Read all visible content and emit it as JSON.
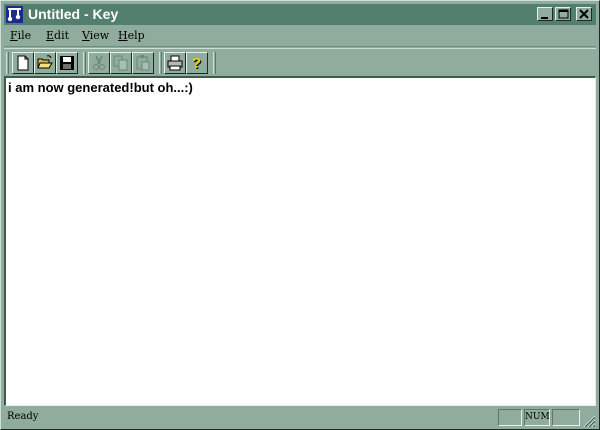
{
  "window": {
    "title": "Untitled - Key",
    "controls": {
      "minimize": "minimize",
      "maximize": "maximize",
      "close": "close"
    }
  },
  "menubar": {
    "items": [
      {
        "label": "File"
      },
      {
        "label": "Edit"
      },
      {
        "label": "View"
      },
      {
        "label": "Help"
      }
    ]
  },
  "toolbar": {
    "buttons": [
      {
        "icon": "new-document-icon",
        "enabled": true
      },
      {
        "icon": "open-folder-icon",
        "enabled": true
      },
      {
        "icon": "save-disk-icon",
        "enabled": true
      },
      {
        "icon": "cut-scissors-icon",
        "enabled": false
      },
      {
        "icon": "copy-icon",
        "enabled": false
      },
      {
        "icon": "paste-clipboard-icon",
        "enabled": false
      },
      {
        "icon": "print-icon",
        "enabled": true
      },
      {
        "icon": "help-question-icon",
        "enabled": true
      }
    ]
  },
  "editor": {
    "content": "i am now generated!but oh...:)"
  },
  "statusbar": {
    "message": "Ready",
    "indicators": [
      "",
      "NUM",
      ""
    ]
  },
  "colors": {
    "titlebar": "#527f6e",
    "face": "#8fac9d",
    "editor_bg": "#ffffff"
  }
}
